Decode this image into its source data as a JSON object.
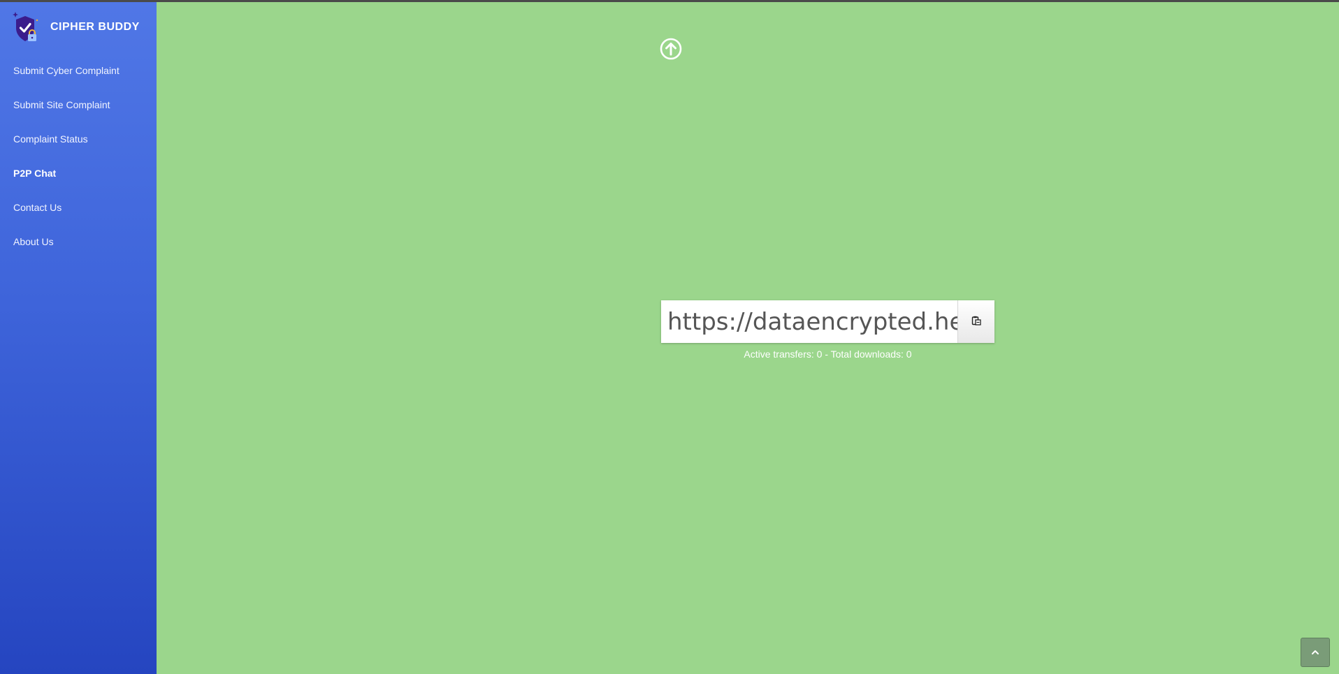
{
  "brand": {
    "name": "CIPHER BUDDY",
    "logo_icon": "shield-check-lock-icon"
  },
  "sidebar": {
    "items": [
      {
        "label": "Submit Cyber Complaint",
        "active": false
      },
      {
        "label": "Submit Site Complaint",
        "active": false
      },
      {
        "label": "Complaint Status",
        "active": false
      },
      {
        "label": "P2P Chat",
        "active": true
      },
      {
        "label": "Contact Us",
        "active": false
      },
      {
        "label": "About Us",
        "active": false
      }
    ]
  },
  "main": {
    "upload_icon": "upload-arrow-circle-icon",
    "share_link": {
      "value": "https://dataencrypted.he",
      "copy_icon": "clipboard-copy-icon"
    },
    "stats": "Active transfers: 0 - Total downloads: 0"
  },
  "scroll_top_icon": "chevron-up-icon",
  "colors": {
    "background": "#9bd68c",
    "sidebar_top": "#5077e6",
    "sidebar_bottom": "#2545c0",
    "logo_purple": "#3b1c8c",
    "scroll_button": "#7a9c78"
  }
}
